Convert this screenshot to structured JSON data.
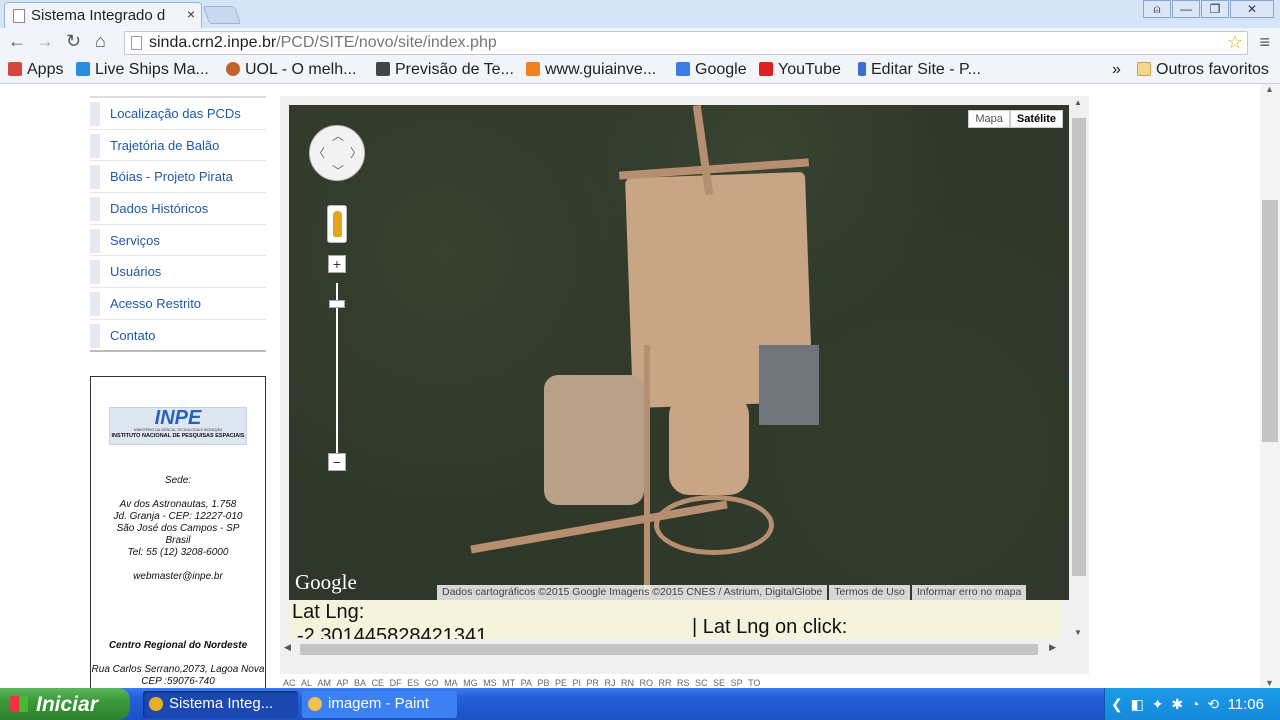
{
  "browser": {
    "tab_title": "Sistema Integrado d",
    "tab_close": "×",
    "window_buttons": [
      "⍝",
      "—",
      "❐",
      "✕"
    ],
    "url_host": "sinda.crn2.inpe.br",
    "url_path": "/PCD/SITE/novo/site/index.php",
    "bookmarks": [
      {
        "label": "Apps",
        "icon": "apps-grid-icon",
        "color": "#d9453b"
      },
      {
        "label": "Live Ships Ma...",
        "icon": "ship-icon",
        "color": "#2a8ee0"
      },
      {
        "label": "UOL - O melh...",
        "icon": "uol-icon",
        "color": "#c0622a"
      },
      {
        "label": "Previsão de Te...",
        "icon": "weather-icon",
        "color": "#444444"
      },
      {
        "label": "www.guiainve...",
        "icon": "guia-icon",
        "color": "#f08020"
      },
      {
        "label": "Google",
        "icon": "google-icon",
        "color": "#3b7be5"
      },
      {
        "label": "YouTube",
        "icon": "youtube-icon",
        "color": "#e02020"
      },
      {
        "label": "Editar Site - P...",
        "icon": "edit-icon",
        "color": "#3a6fd0"
      }
    ],
    "bookmarks_overflow": "»",
    "other_favorites": "Outros favoritos"
  },
  "sidebar": {
    "items": [
      {
        "label": "Localização das PCDs"
      },
      {
        "label": "Trajetória de Balão"
      },
      {
        "label": "Bóias - Projeto Pirata"
      },
      {
        "label": "Dados Históricos"
      },
      {
        "label": "Serviços"
      },
      {
        "label": "Usuários"
      },
      {
        "label": "Acesso Restrito"
      },
      {
        "label": "Contato"
      }
    ]
  },
  "info": {
    "logo_text": "INPE",
    "logo_sub1": "MINISTÉRIO DA CIÊNCIA, TECNOLOGIA E INOVAÇÃO",
    "logo_sub2": "INSTITUTO NACIONAL DE PESQUISAS ESPACIAIS",
    "sede_label": "Sede:",
    "address1": "Av dos Astronautas, 1.758",
    "address2": "Jd. Granja - CEP: 12227-010",
    "address3": "São José dos Campos - SP",
    "address4": "Brasil",
    "phone": "Tel: 55 (12) 3208-6000",
    "email": "webmaster@inpe.br",
    "regional": "Centro Regional do Nordeste",
    "regional_addr": "Rua Carlos Serrano,2073, Lagoa Nova",
    "regional_cep": "CEP :59076-740"
  },
  "map": {
    "type_map": "Mapa",
    "type_satellite": "Satélite",
    "selected_type": "Satélite",
    "zoom_plus": "+",
    "zoom_minus": "−",
    "google_logo": "Google",
    "attribution": "Dados cartográficos ©2015 Google Imagens ©2015 CNES / Astrium, DigitalGlobe",
    "terms": "Termos de Uso",
    "report": "Informar erro no mapa"
  },
  "latlng": {
    "label": "Lat Lng:",
    "value": "-2.301445828421341",
    "click_label": "| Lat Lng on click:"
  },
  "states": [
    "AC",
    "AL",
    "AM",
    "AP",
    "BA",
    "CE",
    "DF",
    "ES",
    "GO",
    "MA",
    "MG",
    "MS",
    "MT",
    "PA",
    "PB",
    "PE",
    "PI",
    "PR",
    "RJ",
    "RN",
    "RO",
    "RR",
    "RS",
    "SC",
    "SE",
    "SP",
    "TO"
  ],
  "taskbar": {
    "start_label": "Iniciar",
    "tasks": [
      {
        "label": "Sistema Integ...",
        "icon": "chrome-icon",
        "color": "#e8b020"
      },
      {
        "label": "imagem - Paint",
        "icon": "paint-icon",
        "color": "#f0c050"
      }
    ],
    "tray_icons": "❮ ◧ ✦ ✱ ◔ ⟲",
    "clock": "11:06"
  }
}
